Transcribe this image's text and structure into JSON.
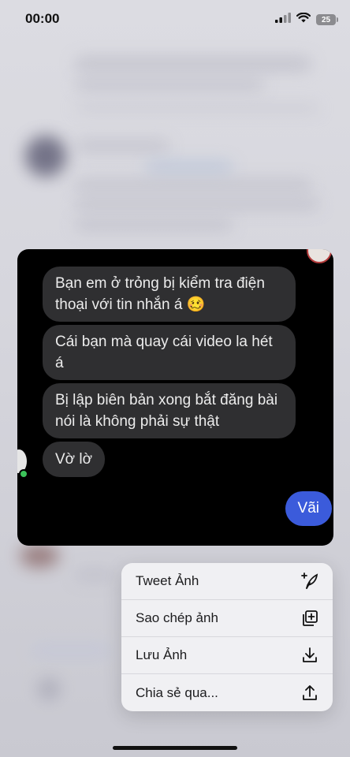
{
  "status_bar": {
    "time": "00:00",
    "battery": "25"
  },
  "chat": {
    "messages": [
      {
        "text": "Bạn em ở trỏng bị kiểm tra điện thoại với tin nhắn á 🥴"
      },
      {
        "text": "Cái bạn mà quay cái video la hét á"
      },
      {
        "text": "Bị lập biên bản xong bắt đăng bài nói là không phải sự thật"
      },
      {
        "text": "Vờ lờ"
      }
    ],
    "reply": "Vãi",
    "colors": {
      "bubble": "#2f2f31",
      "reply_bubble": "#3b5bdb",
      "online": "#3cc35a"
    }
  },
  "menu": {
    "items": [
      {
        "label": "Tweet Ảnh",
        "icon": "tweet-add-icon"
      },
      {
        "label": "Sao chép ảnh",
        "icon": "copy-icon"
      },
      {
        "label": "Lưu Ảnh",
        "icon": "download-icon"
      },
      {
        "label": "Chia sẻ qua...",
        "icon": "share-icon"
      }
    ]
  }
}
